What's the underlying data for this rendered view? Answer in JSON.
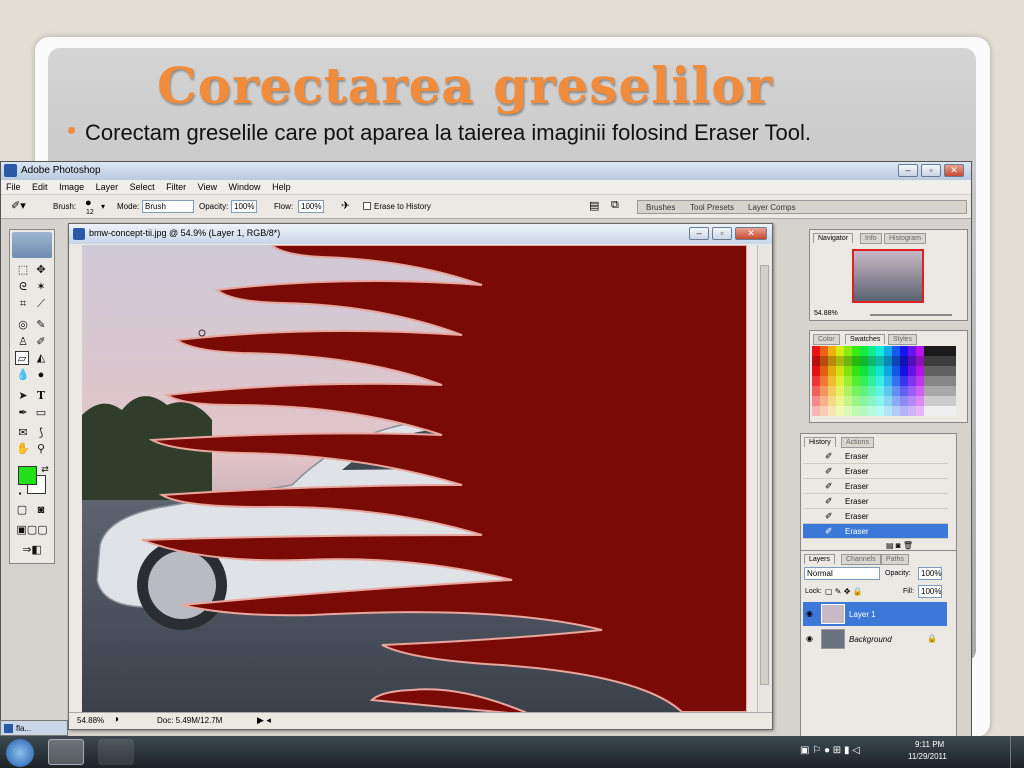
{
  "slide": {
    "title": "Corectarea greselilor",
    "bullet": "Corectam greselile care pot aparea la taierea imaginii folosind Eraser Tool."
  },
  "app": {
    "title": "Adobe Photoshop",
    "menus": [
      "File",
      "Edit",
      "Image",
      "Layer",
      "Select",
      "Filter",
      "View",
      "Window",
      "Help"
    ],
    "options": {
      "brush_label": "Brush:",
      "brush_size": "12",
      "mode_label": "Mode:",
      "mode_value": "Brush",
      "opacity_label": "Opacity:",
      "opacity_value": "100%",
      "flow_label": "Flow:",
      "flow_value": "100%",
      "erase_history": "Erase to History"
    },
    "wells": [
      "Brushes",
      "Tool Presets",
      "Layer Comps"
    ]
  },
  "document": {
    "title": "bmw-concept-tii.jpg @ 54.9% (Layer 1, RGB/8*)",
    "zoom": "54.88%",
    "doc_size": "Doc: 5.49M/12.7M"
  },
  "navigator": {
    "tabs": [
      "Navigator",
      "Info",
      "Histogram"
    ],
    "zoom": "54.88%"
  },
  "color_panel": {
    "tabs": [
      "Color",
      "Swatches",
      "Styles"
    ]
  },
  "history": {
    "tabs": [
      "History",
      "Actions"
    ],
    "items": [
      "Eraser",
      "Eraser",
      "Eraser",
      "Eraser",
      "Eraser",
      "Eraser"
    ]
  },
  "layers": {
    "tabs": [
      "Layers",
      "Channels",
      "Paths"
    ],
    "blend": "Normal",
    "opacity_label": "Opacity:",
    "opacity_value": "100%",
    "lock_label": "Lock:",
    "fill_label": "Fill:",
    "fill_value": "100%",
    "items": [
      "Layer 1",
      "Background"
    ]
  },
  "taskbar": {
    "time": "9:11 PM",
    "date": "11/29/2011",
    "item": "fla..."
  },
  "colors": {
    "accent": "#f08c3c",
    "flame": "#7a0a05",
    "foreground": "#22e01a",
    "selection": "#3c78d8"
  }
}
